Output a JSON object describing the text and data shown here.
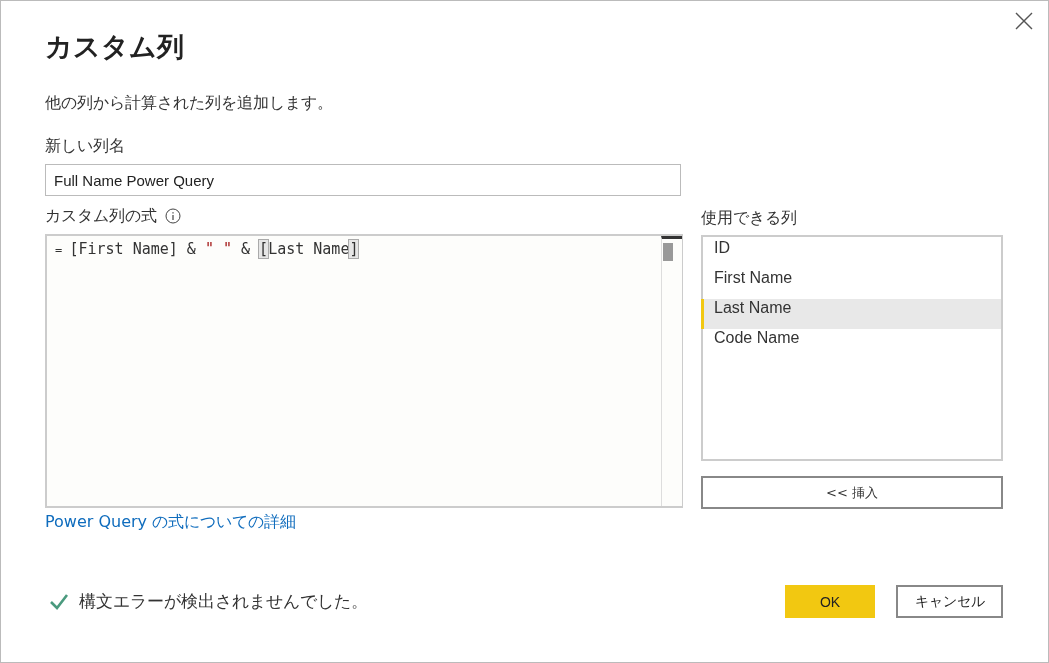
{
  "dialog": {
    "title": "カスタム列",
    "description": "他の列から計算された列を追加します。"
  },
  "name_field": {
    "label": "新しい列名",
    "value": "Full Name Power Query"
  },
  "formula": {
    "label": "カスタム列の式",
    "tokens": [
      {
        "text": "= ",
        "kind": "operator"
      },
      {
        "text": "[First Name] & ",
        "kind": "plain"
      },
      {
        "text": "\" \"",
        "kind": "string"
      },
      {
        "text": " & ",
        "kind": "plain"
      },
      {
        "text": "[",
        "kind": "bracket-match"
      },
      {
        "text": "Last Name",
        "kind": "plain"
      },
      {
        "text": "]",
        "kind": "bracket-match"
      }
    ]
  },
  "help_link": "Power Query の式についての詳細",
  "columns": {
    "label": "使用できる列",
    "items": [
      {
        "label": "ID",
        "selected": false
      },
      {
        "label": "First Name",
        "selected": false
      },
      {
        "label": "Last Name",
        "selected": true
      },
      {
        "label": "Code Name",
        "selected": false
      }
    ],
    "insert_button": "<< 挿入"
  },
  "status": {
    "ok": true,
    "message": "構文エラーが検出されませんでした。"
  },
  "buttons": [
    {
      "label": "OK",
      "kind": "primary"
    },
    {
      "label": "キャンセル",
      "kind": "secondary"
    }
  ]
}
